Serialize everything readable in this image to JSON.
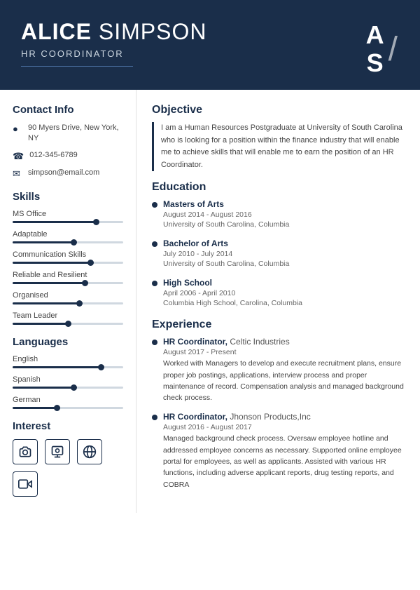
{
  "header": {
    "first_name": "ALICE",
    "last_name": "SIMPSON",
    "title": "HR COORDINATOR",
    "monogram_a": "A",
    "monogram_s": "S"
  },
  "sidebar": {
    "contact_section": "Contact Info",
    "contact": {
      "address": "90 Myers Drive, New York, NY",
      "phone": "012-345-6789",
      "email": "simpson@email.com"
    },
    "skills_section": "Skills",
    "skills": [
      {
        "name": "MS Office",
        "fill": 75,
        "dot": 75
      },
      {
        "name": "Adaptable",
        "fill": 55,
        "dot": 55
      },
      {
        "name": "Communication Skills",
        "fill": 70,
        "dot": 70
      },
      {
        "name": "Reliable and Resilient",
        "fill": 65,
        "dot": 65
      },
      {
        "name": "Organised",
        "fill": 60,
        "dot": 60
      },
      {
        "name": "Team Leader",
        "fill": 50,
        "dot": 50
      }
    ],
    "languages_section": "Languages",
    "languages": [
      {
        "name": "English",
        "fill": 80,
        "dot": 80
      },
      {
        "name": "Spanish",
        "fill": 55,
        "dot": 55
      },
      {
        "name": "German",
        "fill": 40,
        "dot": 40
      }
    ],
    "interest_section": "Interest",
    "interests": [
      {
        "icon": "📷",
        "label": "camera-icon"
      },
      {
        "icon": "👤",
        "label": "person-icon"
      },
      {
        "icon": "🌐",
        "label": "globe-icon"
      },
      {
        "icon": "🎬",
        "label": "video-icon"
      }
    ]
  },
  "main": {
    "objective_section": "Objective",
    "objective_text": "I am a Human Resources Postgraduate at University of South Carolina who is looking for a position within the finance industry that will enable me to achieve skills that will enable me to earn the position of an HR Coordinator.",
    "education_section": "Education",
    "education": [
      {
        "degree": "Masters of Arts",
        "dates": "August 2014 - August 2016",
        "institution": "University of South Carolina, Columbia"
      },
      {
        "degree": "Bachelor of Arts",
        "dates": "July 2010 - July 2014",
        "institution": "University of South Carolina, Columbia"
      },
      {
        "degree": "High School",
        "dates": "April 2006 - April 2010",
        "institution": "Columbia High School, Carolina, Columbia"
      }
    ],
    "experience_section": "Experience",
    "experience": [
      {
        "title": "HR Coordinator",
        "company": "Celtic Industries",
        "dates": "August 2017 - Present",
        "description": "Worked with Managers to develop and execute recruitment plans, ensure proper job postings, applications, interview process and proper maintenance of record. Compensation analysis and managed background check process."
      },
      {
        "title": "HR Coordinator",
        "company": "Jhonson Products,Inc",
        "dates": "August 2016 - August 2017",
        "description": "Managed background check process. Oversaw employee hotline and addressed employee concerns as necessary. Supported online employee portal for employees, as well as applicants. Assisted with various HR functions, including adverse applicant reports, drug testing reports, and COBRA"
      }
    ]
  }
}
